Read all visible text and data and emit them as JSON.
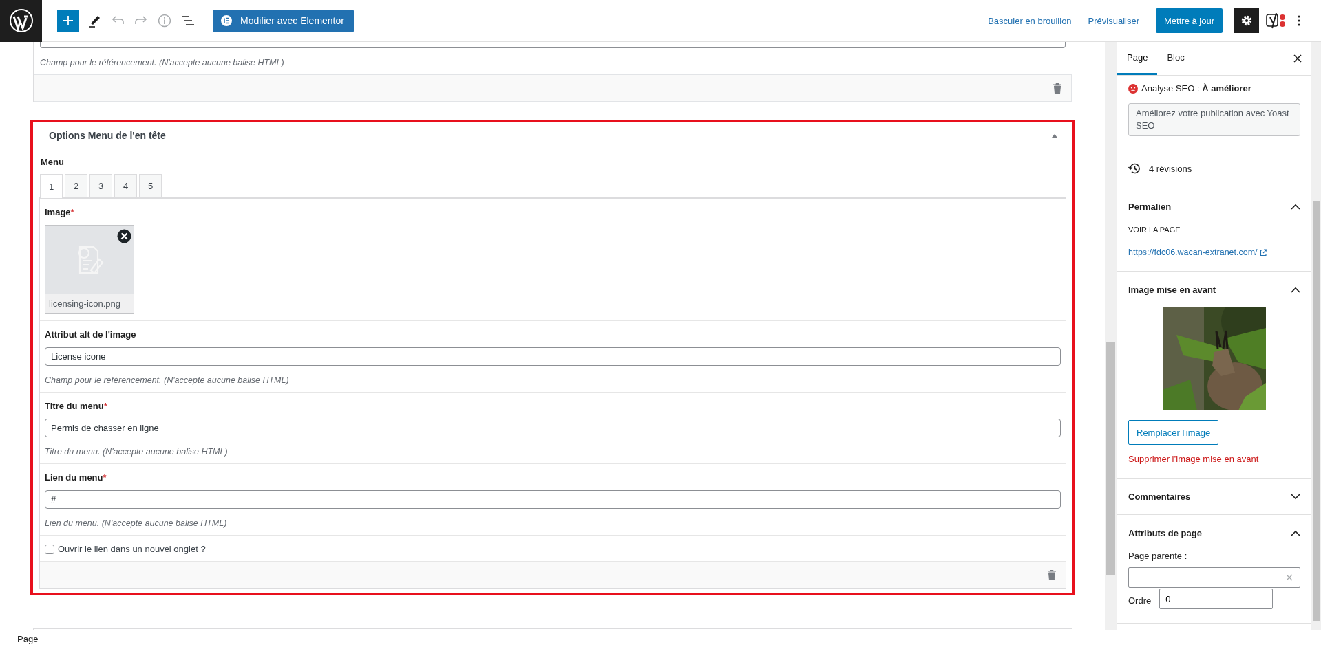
{
  "toolbar": {
    "tools": [
      {
        "kind": "add",
        "disabled": false
      },
      {
        "kind": "edit",
        "disabled": false
      },
      {
        "kind": "undo",
        "disabled": true
      },
      {
        "kind": "redo",
        "disabled": true
      },
      {
        "kind": "info",
        "disabled": true
      },
      {
        "kind": "outline",
        "disabled": false
      }
    ],
    "elementor_button": "Modifier avec Elementor",
    "draft_link": "Basculer en brouillon",
    "preview_link": "Prévisualiser",
    "update_button": "Mettre à jour"
  },
  "editor": {
    "previous_panel": {
      "help": "Champ pour le référencement. (N'accepte aucune balise HTML)"
    },
    "panel": {
      "title": "Options Menu de l'en tête",
      "expanded": true,
      "menu_label": "Menu",
      "tabs": [
        {
          "label": "1",
          "selected": true
        },
        {
          "label": "2",
          "selected": false
        },
        {
          "label": "3",
          "selected": false
        },
        {
          "label": "4",
          "selected": false
        },
        {
          "label": "5",
          "selected": false
        }
      ],
      "fields": [
        {
          "label": "Image",
          "required_mark": "*",
          "filename": "licensing-icon.png"
        },
        {
          "kind": "text",
          "label": "Attribut alt de l'image",
          "value": "License icone",
          "help": "Champ pour le référencement. (N'accepte aucune balise HTML)"
        },
        {
          "kind": "text",
          "label": "Titre du menu",
          "required_mark": "*",
          "value": "Permis de chasser en ligne",
          "help": "Titre du menu. (N'accepte aucune balise HTML)"
        },
        {
          "kind": "text",
          "label": "Lien du menu",
          "required_mark": "*",
          "value": "#",
          "help": "Lien du menu. (N'accepte aucune balise HTML)"
        },
        {
          "kind": "checkbox",
          "label": "Ouvrir le lien dans un nouvel onglet ?",
          "checked": false
        }
      ]
    }
  },
  "sidebar": {
    "tabs": [
      {
        "label": "Page",
        "selected": true
      },
      {
        "label": "Bloc",
        "selected": false
      }
    ],
    "seo": {
      "label": "Analyse SEO : ",
      "status": "À améliorer",
      "button": "Améliorez votre publication avec Yoast SEO"
    },
    "revisions": "4 révisions",
    "sections": [
      {
        "kind": "permalink",
        "title": "Permalien",
        "expanded": true,
        "caption": "VOIR LA PAGE",
        "link": "https://fdc06.wacan-extranet.com/"
      },
      {
        "kind": "featured",
        "title": "Image mise en avant",
        "expanded": true,
        "replace_button": "Remplacer l'image",
        "remove_link": "Supprimer l’image mise en avant"
      },
      {
        "kind": "plain",
        "title": "Commentaires",
        "expanded": false
      },
      {
        "kind": "attributes",
        "title": "Attributs de page",
        "expanded": true,
        "parent_label": "Page parente :",
        "order_label": "Ordre",
        "order_value": "0"
      }
    ]
  },
  "status_bar": {
    "breadcrumb": "Page"
  }
}
